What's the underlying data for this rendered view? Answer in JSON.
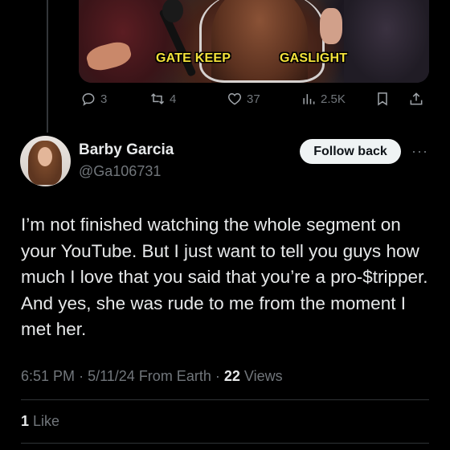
{
  "media": {
    "captions": [
      "GATE KEEP",
      "GASLIGHT"
    ]
  },
  "actions": {
    "reply_count": "3",
    "repost_count": "4",
    "like_count": "37",
    "view_count": "2.5K"
  },
  "reply": {
    "name": "Barby Garcia",
    "handle": "@Ga106731",
    "follow_label": "Follow back",
    "more_label": "···",
    "text": "I’m not finished watching the whole segment on your YouTube. But I just want to tell you guys how much I love that you said that you’re a pro-$tripper. And yes, she was rude to me from the moment I met her.",
    "time": "6:51 PM",
    "date": "5/11/24",
    "source": "From Earth",
    "views_count": "22",
    "views_label": "Views",
    "likes_count": "1",
    "likes_label": "Like"
  },
  "icons": {
    "reply": "reply-icon",
    "repost": "repost-icon",
    "like": "heart-icon",
    "views": "analytics-icon",
    "bookmark": "bookmark-icon",
    "share": "share-icon"
  },
  "colors": {
    "background": "#000000",
    "text": "#e7e9ea",
    "secondary": "#71767b",
    "caption": "#f3e23a",
    "button_bg": "#eff3f4"
  }
}
